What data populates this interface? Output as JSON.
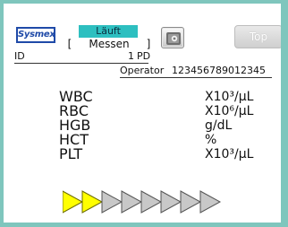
{
  "header": {
    "logo_text": "Sysmex",
    "status": "Läuft",
    "mode_open": "[",
    "mode": "Messen",
    "mode_close": "]",
    "top_button_label": "Top",
    "tool_icon": "analyzer-icon"
  },
  "sample": {
    "id_label": "ID",
    "id_value": "1",
    "pd_label": "PD",
    "operator_label": "Operator",
    "operator_value": "123456789012345"
  },
  "results": [
    {
      "parameter": "WBC",
      "unit": "X10³/μL"
    },
    {
      "parameter": "RBC",
      "unit": "X10⁶/μL"
    },
    {
      "parameter": "HGB",
      "unit": "g/dL"
    },
    {
      "parameter": "HCT",
      "unit": "%"
    },
    {
      "parameter": "PLT",
      "unit": "X10³/μL"
    }
  ],
  "progress": {
    "completed_steps": 2,
    "total_steps": 8,
    "active_color": "#ffff00",
    "inactive_color": "#c8c8c8"
  },
  "colors": {
    "frame": "#7fc6bd",
    "status_badge": "#2dbfc0",
    "logo_blue": "#1f4aa8"
  }
}
